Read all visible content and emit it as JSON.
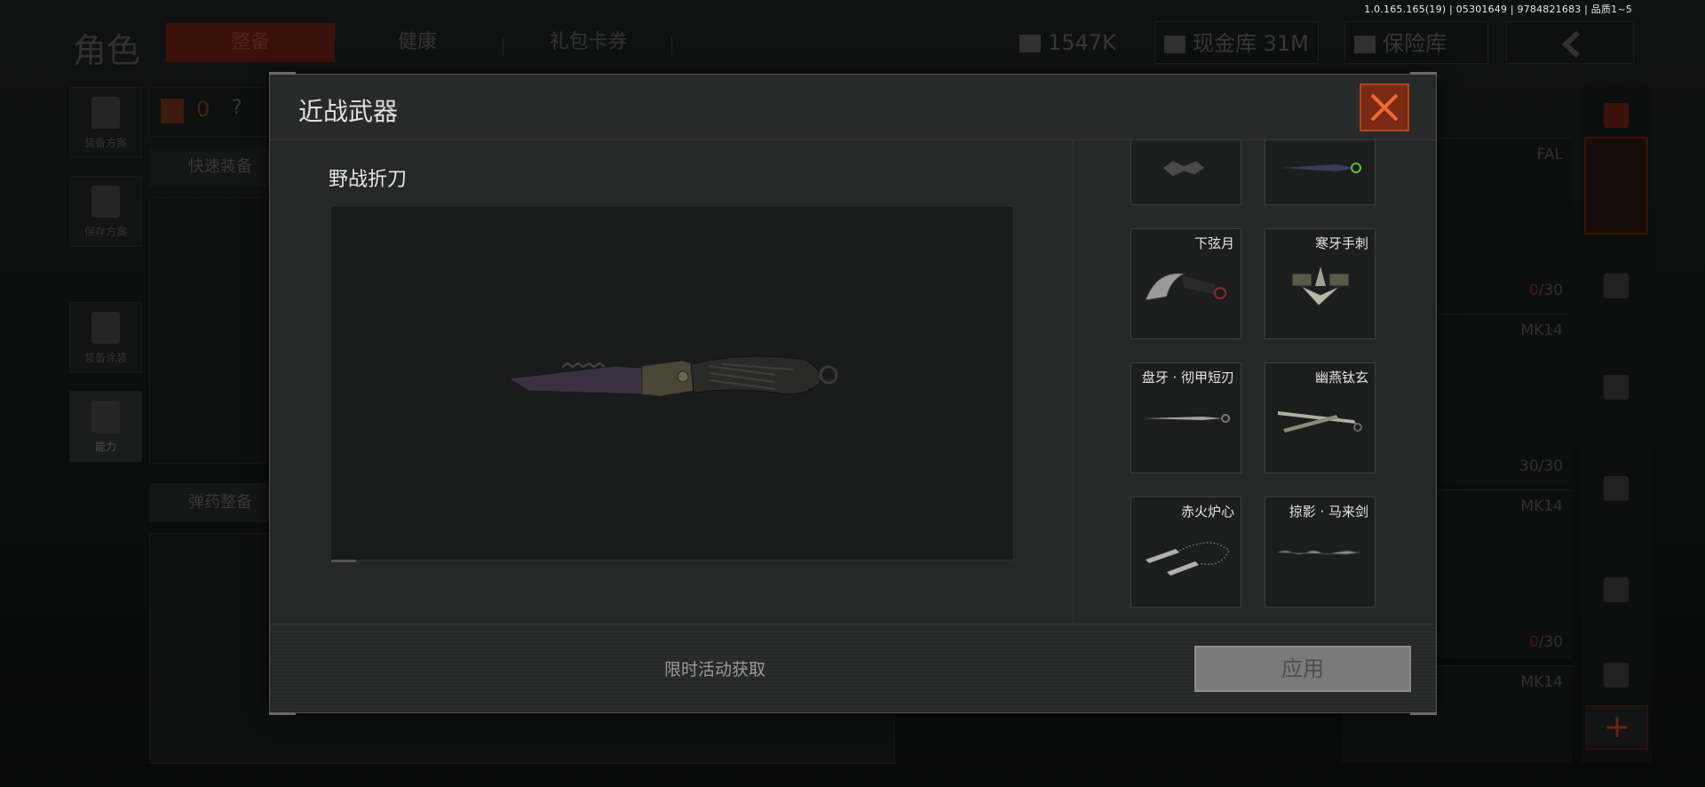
{
  "version_text": "1.0.165.165(19) | 05301649 | 9784821683 | 品质1~5",
  "header": {
    "title": "角色",
    "tabs": [
      {
        "label": "整备",
        "active": true
      },
      {
        "label": "健康",
        "active": false
      },
      {
        "label": "礼包卡券",
        "active": false
      }
    ],
    "currency": "1547K",
    "cash_vault": "现金库 31M",
    "safe_box": "保险库"
  },
  "left_dock": {
    "items": [
      {
        "label": "装备方案",
        "icon": "vest-icon"
      },
      {
        "label": "保存方案",
        "icon": "download-icon"
      },
      {
        "label": "装备涂装",
        "icon": "helmet-icon"
      },
      {
        "label": "能力",
        "icon": "lightning-icon"
      }
    ],
    "armor_count": "0",
    "help": "?",
    "quick_equip": "快速装备",
    "ammo_organize": "弹药整备"
  },
  "right_weapons": [
    {
      "name": "FAL",
      "count_cur": "0",
      "count_max": "/30"
    },
    {
      "name": "MK14",
      "count_cur": "30",
      "count_max": "/30"
    },
    {
      "name": "MK14",
      "count_cur": "0",
      "count_max": "/30"
    },
    {
      "name": "MK14",
      "count_cur": "",
      "count_max": ""
    }
  ],
  "dialog": {
    "title": "近战武器",
    "selected_item": "野战折刀",
    "source_text": "限时活动获取",
    "apply_label": "应用",
    "list": [
      {
        "name": "",
        "icon": "knife-partial-icon"
      },
      {
        "name": "",
        "icon": "knife-partial-icon"
      },
      {
        "name": "下弦月",
        "icon": "karambit-icon"
      },
      {
        "name": "寒牙手刺",
        "icon": "claw-icon"
      },
      {
        "name": "盘牙 · 彻甲短刃",
        "icon": "dagger-icon"
      },
      {
        "name": "幽燕钛玄",
        "icon": "twin-blade-icon"
      },
      {
        "name": "赤火炉心",
        "icon": "kunai-chain-icon"
      },
      {
        "name": "掠影 · 马来剑",
        "icon": "kris-icon"
      }
    ]
  },
  "colors": {
    "accent": "#b0451f",
    "close_bg": "#7a2a13",
    "apply_bg": "#7a7a7a",
    "dialog_bg": "#262727"
  }
}
